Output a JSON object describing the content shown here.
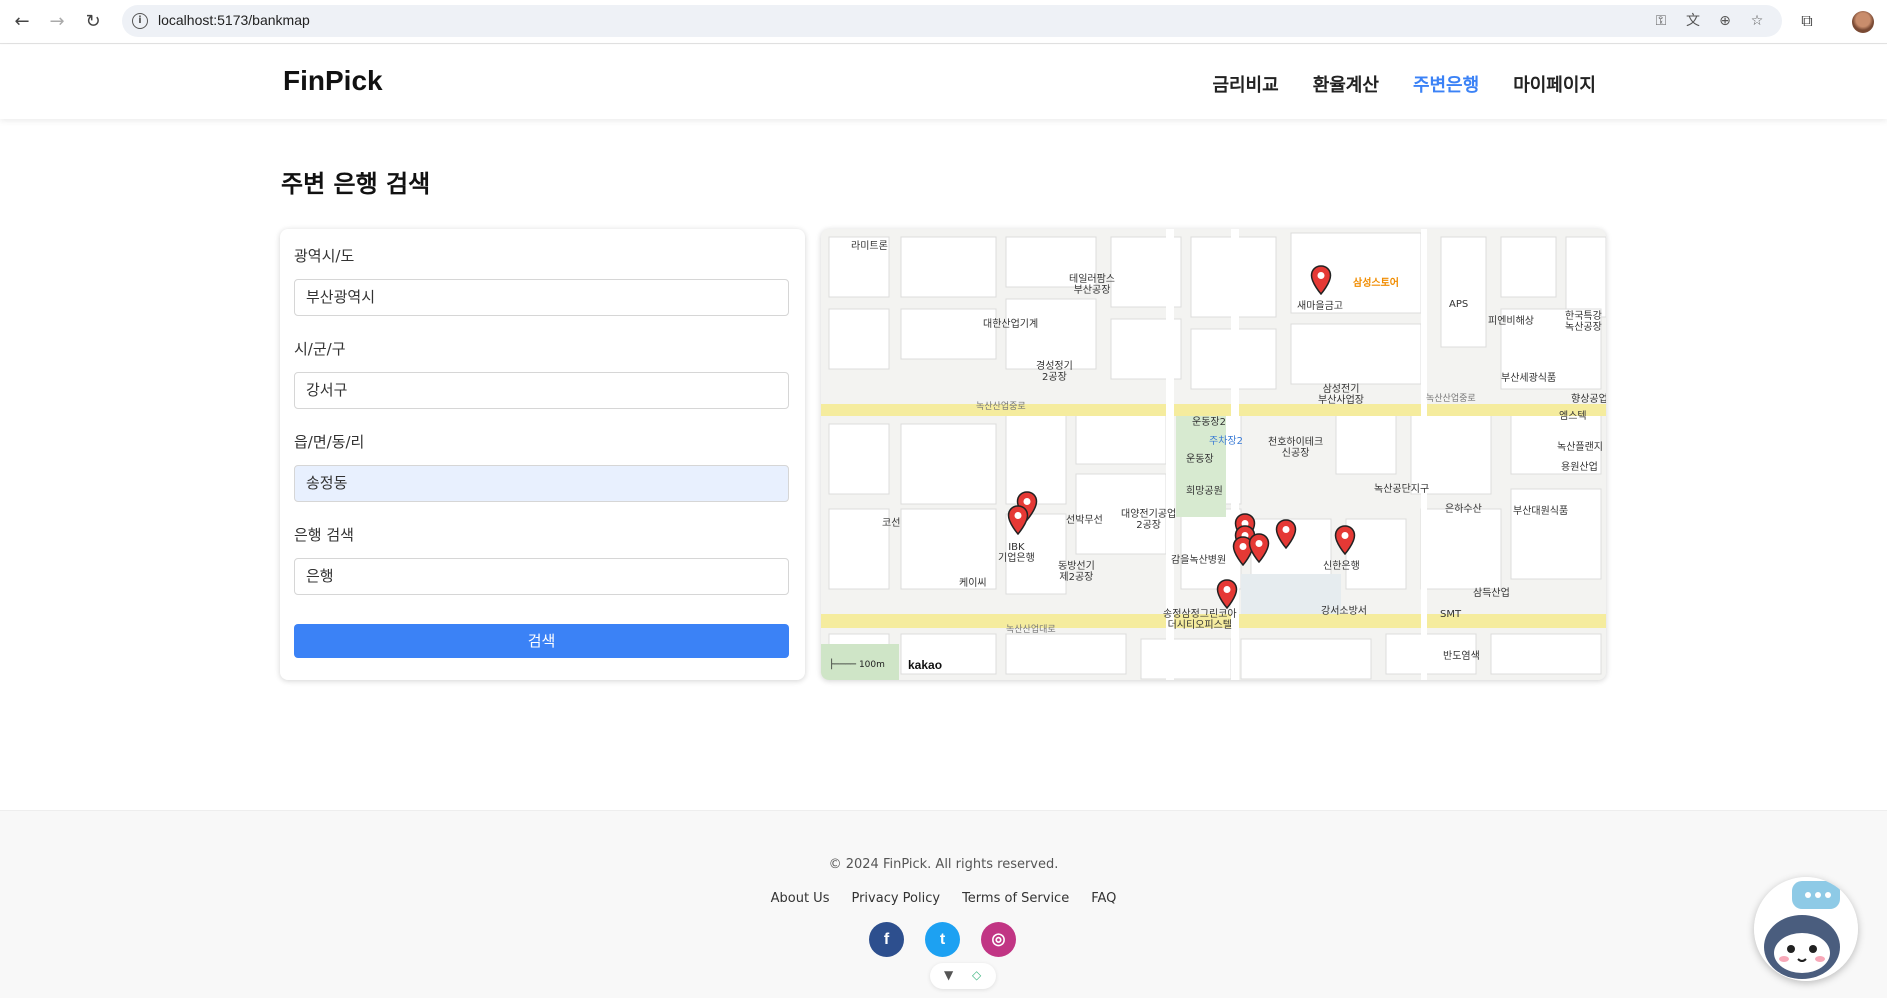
{
  "browser": {
    "url": "localhost:5173/bankmap"
  },
  "header": {
    "logo": "FinPick",
    "nav": [
      {
        "label": "금리비교",
        "active": false
      },
      {
        "label": "환율계산",
        "active": false
      },
      {
        "label": "주변은행",
        "active": true
      },
      {
        "label": "마이페이지",
        "active": false
      }
    ]
  },
  "page": {
    "title": "주변 은행 검색"
  },
  "form": {
    "region_label": "광역시/도",
    "region_value": "부산광역시",
    "district_label": "시/군/구",
    "district_value": "강서구",
    "town_label": "읍/면/동/리",
    "town_value": "송정동",
    "bank_label": "은행 검색",
    "bank_value": "은행",
    "submit_label": "검색"
  },
  "map": {
    "places": {
      "p1": "라미트론",
      "p2": "테일러팜스\n부산공장",
      "p3": "삼성스토어",
      "p4": "새마을금고",
      "p5": "APS",
      "p6": "피엔비해상",
      "p7": "한국특강\n녹산공장",
      "p8": "대한산업기계",
      "p9": "경성정기\n2공장",
      "p10": "삼성전기\n부산사업장",
      "p11": "부산세광식품",
      "p12": "향상공업",
      "p13": "엠스텍",
      "p14": "운동장2",
      "p15": "주차장2",
      "p16": "천호하이테크\n신공장",
      "p17": "운동장",
      "p18": "희망공원",
      "p19": "녹산플랜지",
      "p20": "용원산업",
      "p21": "녹산공단지구",
      "p22": "은하수산",
      "p23": "부산대원식품",
      "p24": "코선",
      "p25": "선박무선",
      "p26": "대양전기공업\n2공장",
      "p27": "IBK\n기업은행",
      "p28": "동방선기\n제2공장",
      "p29": "감을녹산병원",
      "p30": "신한은행",
      "p31": "케이씨",
      "p32": "송정삼정그린코아\n더시티오피스텔",
      "p33": "강서소방서",
      "p34": "SMT",
      "p35": "삼득산업",
      "p36": "반도염색"
    },
    "roads": {
      "r1": "녹산산업중로",
      "r2": "녹산산업중로",
      "r3": "녹산산업대로"
    },
    "scale_label": "100m",
    "provider": "kakao"
  },
  "footer": {
    "copyright": "© 2024 FinPick. All rights reserved.",
    "links": [
      "About Us",
      "Privacy Policy",
      "Terms of Service",
      "FAQ"
    ],
    "social": [
      {
        "name": "facebook",
        "glyph": "f",
        "color": "#2d4f8e"
      },
      {
        "name": "twitter",
        "glyph": "t",
        "color": "#1da1f2"
      },
      {
        "name": "instagram",
        "glyph": "◎",
        "color": "#c13584"
      }
    ]
  },
  "colors": {
    "accent": "#3b82f6",
    "pin": "#e53935"
  }
}
